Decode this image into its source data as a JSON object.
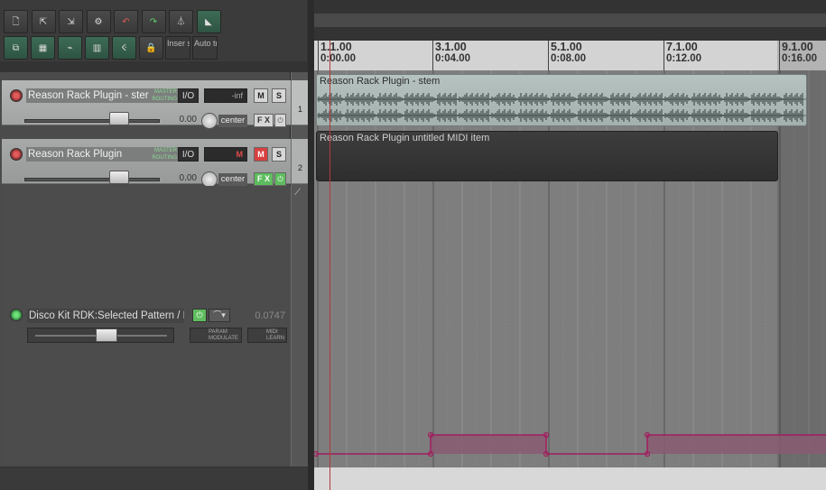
{
  "toolbar": {
    "row1": [
      {
        "name": "new-project-icon",
        "glyph": "🗋"
      },
      {
        "name": "open-project-icon",
        "glyph": "⇱"
      },
      {
        "name": "save-project-icon",
        "glyph": "⇲"
      },
      {
        "name": "project-settings-icon",
        "glyph": "⚙"
      },
      {
        "name": "undo-icon",
        "glyph": "↶"
      },
      {
        "name": "redo-icon",
        "glyph": "↷"
      },
      {
        "name": "metronome-icon",
        "glyph": "⏃"
      },
      {
        "name": "auto-crossfade-icon",
        "glyph": "◣"
      }
    ],
    "row2": [
      {
        "name": "ripple-edit-icon",
        "glyph": "⧉"
      },
      {
        "name": "grid-snap-icon",
        "glyph": "▦"
      },
      {
        "name": "envelope-lock-icon",
        "glyph": "⌁"
      },
      {
        "name": "grid-lines-icon",
        "glyph": "▥"
      },
      {
        "name": "snap-magnet-icon",
        "glyph": "Ⲵ"
      },
      {
        "name": "lock-icon",
        "glyph": "🔒"
      }
    ],
    "insert_label": "Inser separ",
    "auto_label": "Auto trim/"
  },
  "tracks": [
    {
      "number": "1",
      "name": "Reason Rack Plugin - ster",
      "routing": "MASTER ROUTING",
      "io": "I/O",
      "meter": "-inf",
      "mute": "M",
      "solo": "S",
      "volume": "0.00",
      "pan": "center",
      "fx": "F X"
    },
    {
      "number": "2",
      "name": "Reason Rack Plugin",
      "routing": "MASTER ROUTING",
      "io": "I/O",
      "meter": "M",
      "mute": "M",
      "solo": "S",
      "volume": "0.00",
      "pan": "center",
      "fx": "F X"
    }
  ],
  "envelope": {
    "name": "Disco Kit RDK:Selected Pattern / Re",
    "value": "0.0747",
    "param_button": "PARAM MODULATE",
    "midi_button": "MIDI LEARN"
  },
  "ruler": [
    {
      "bar": "1.1.00",
      "time": "0:00.00"
    },
    {
      "bar": "3.1.00",
      "time": "0:04.00"
    },
    {
      "bar": "5.1.00",
      "time": "0:08.00"
    },
    {
      "bar": "7.1.00",
      "time": "0:12.00"
    },
    {
      "bar": "9.1.00",
      "time": "0:16.00"
    }
  ],
  "items": {
    "audio_label": "Reason Rack Plugin - stem",
    "midi_label": "Reason Rack Plugin untitled MIDI item"
  },
  "colors": {
    "envelope": "#a21d5e",
    "envelope_fill": "#8a5a72",
    "cursor": "#b33b3b",
    "mute_on": "#d84141",
    "fx_on": "#5ebd5e"
  }
}
